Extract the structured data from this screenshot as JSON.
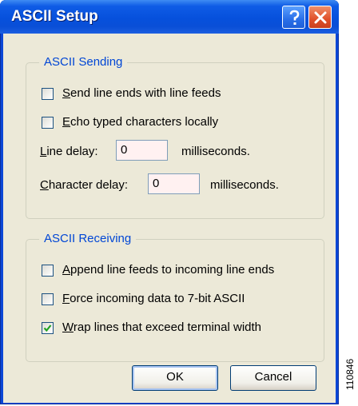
{
  "window": {
    "title": "ASCII Setup"
  },
  "titlebar": {
    "help_icon": "question-mark-icon",
    "close_icon": "x-close-icon"
  },
  "sending": {
    "legend": "ASCII Sending",
    "send_line_ends": {
      "underline": "S",
      "rest": "end line ends with line feeds",
      "checked": false
    },
    "echo_typed": {
      "underline": "E",
      "rest": "cho typed characters locally",
      "checked": false
    },
    "line_delay": {
      "underline": "L",
      "rest": "ine delay:",
      "value": "0",
      "unit": "milliseconds."
    },
    "char_delay": {
      "underline": "C",
      "rest": "haracter delay:",
      "value": "0",
      "unit": "milliseconds."
    }
  },
  "receiving": {
    "legend": "ASCII Receiving",
    "append_line_feeds": {
      "underline": "A",
      "rest": "ppend line feeds to incoming line ends",
      "checked": false
    },
    "force_7bit": {
      "underline": "F",
      "rest": "orce incoming data to 7-bit ASCII",
      "checked": false
    },
    "wrap_lines": {
      "underline": "W",
      "rest": "rap lines that exceed terminal width",
      "checked": true
    }
  },
  "buttons": {
    "ok": "OK",
    "cancel": "Cancel"
  },
  "figure_number": "110846"
}
